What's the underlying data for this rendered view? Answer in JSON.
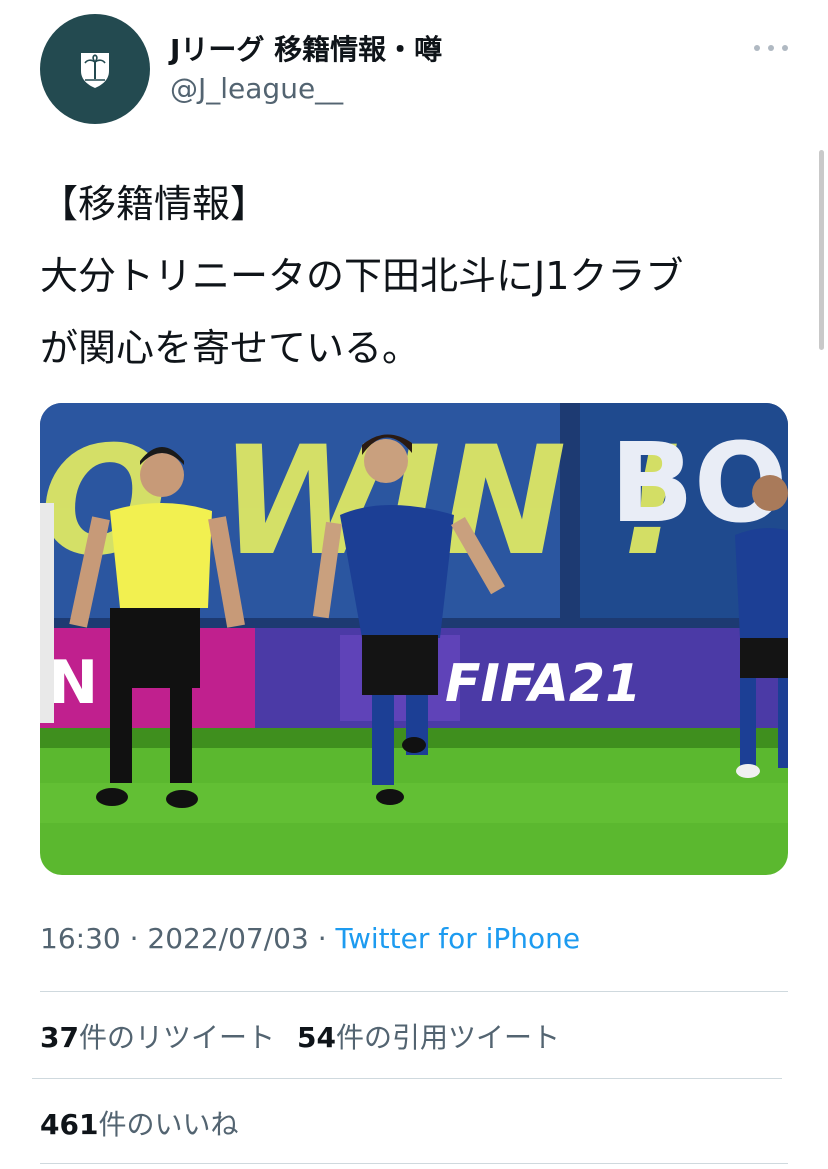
{
  "author": {
    "name": "Jリーグ 移籍情報・噂",
    "handle": "@J_league__"
  },
  "tweet": {
    "line1": "【移籍情報】",
    "line2": "大分トリニータの下田北斗にJ1クラブ",
    "line3": "が関心を寄せている。"
  },
  "media": {
    "banner_left": "O WIN !",
    "banner_right": "BO",
    "board_text": "FIFA21",
    "board_left": "N"
  },
  "meta": {
    "time": "16:30",
    "sep1": " · ",
    "date": "2022/07/03",
    "sep2": " · ",
    "source": "Twitter for iPhone"
  },
  "stats": {
    "retweets_count": "37",
    "retweets_label": "件のリツイート",
    "quotes_count": "54",
    "quotes_label": "件の引用ツイート",
    "likes_count": "461",
    "likes_label": "件のいいね"
  },
  "colors": {
    "avatar_bg": "#234a50",
    "link": "#1d9bf0",
    "muted": "#536471"
  },
  "icons": {
    "avatar": "palm-crest-icon",
    "more": "more-dots-icon"
  }
}
